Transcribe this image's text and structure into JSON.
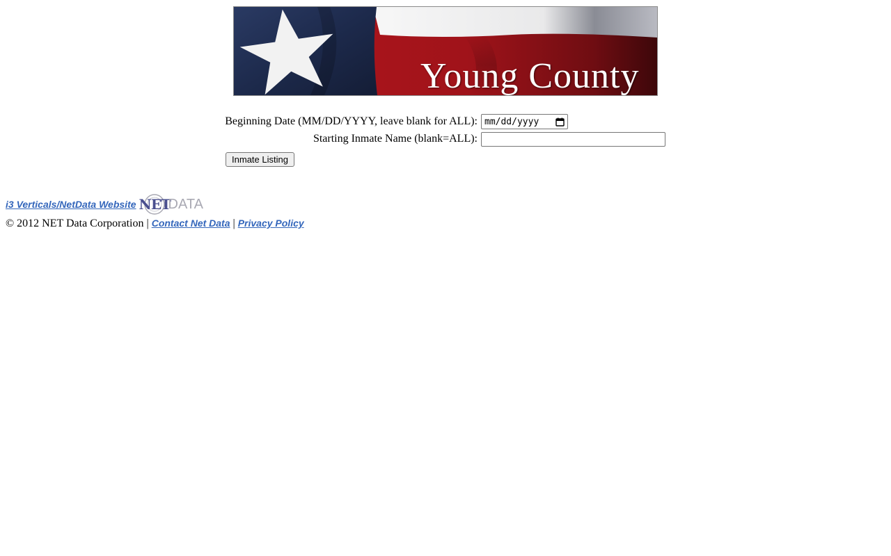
{
  "banner": {
    "title": "Young County",
    "image_alt": "Texas flag banner",
    "colors": {
      "blue": "#1f2c4f",
      "red": "#a5141b",
      "white": "#f4f4f4"
    }
  },
  "form": {
    "date_label": "Beginning Date (MM/DD/YYYY, leave blank for ALL):",
    "date_placeholder": "mm/dd/yyyy",
    "name_label": "Starting Inmate Name (blank=ALL):",
    "name_value": "",
    "submit_label": "Inmate Listing"
  },
  "footer": {
    "vendor_link": "i3 Verticals/NetData Website",
    "logo": {
      "part1": "NET",
      "part2": "DATA"
    },
    "copyright": "© 2012 NET Data Corporation",
    "separator": "|",
    "contact_link": "Contact Net Data",
    "privacy_link": "Privacy Policy",
    "link_color": "#3366bb"
  }
}
